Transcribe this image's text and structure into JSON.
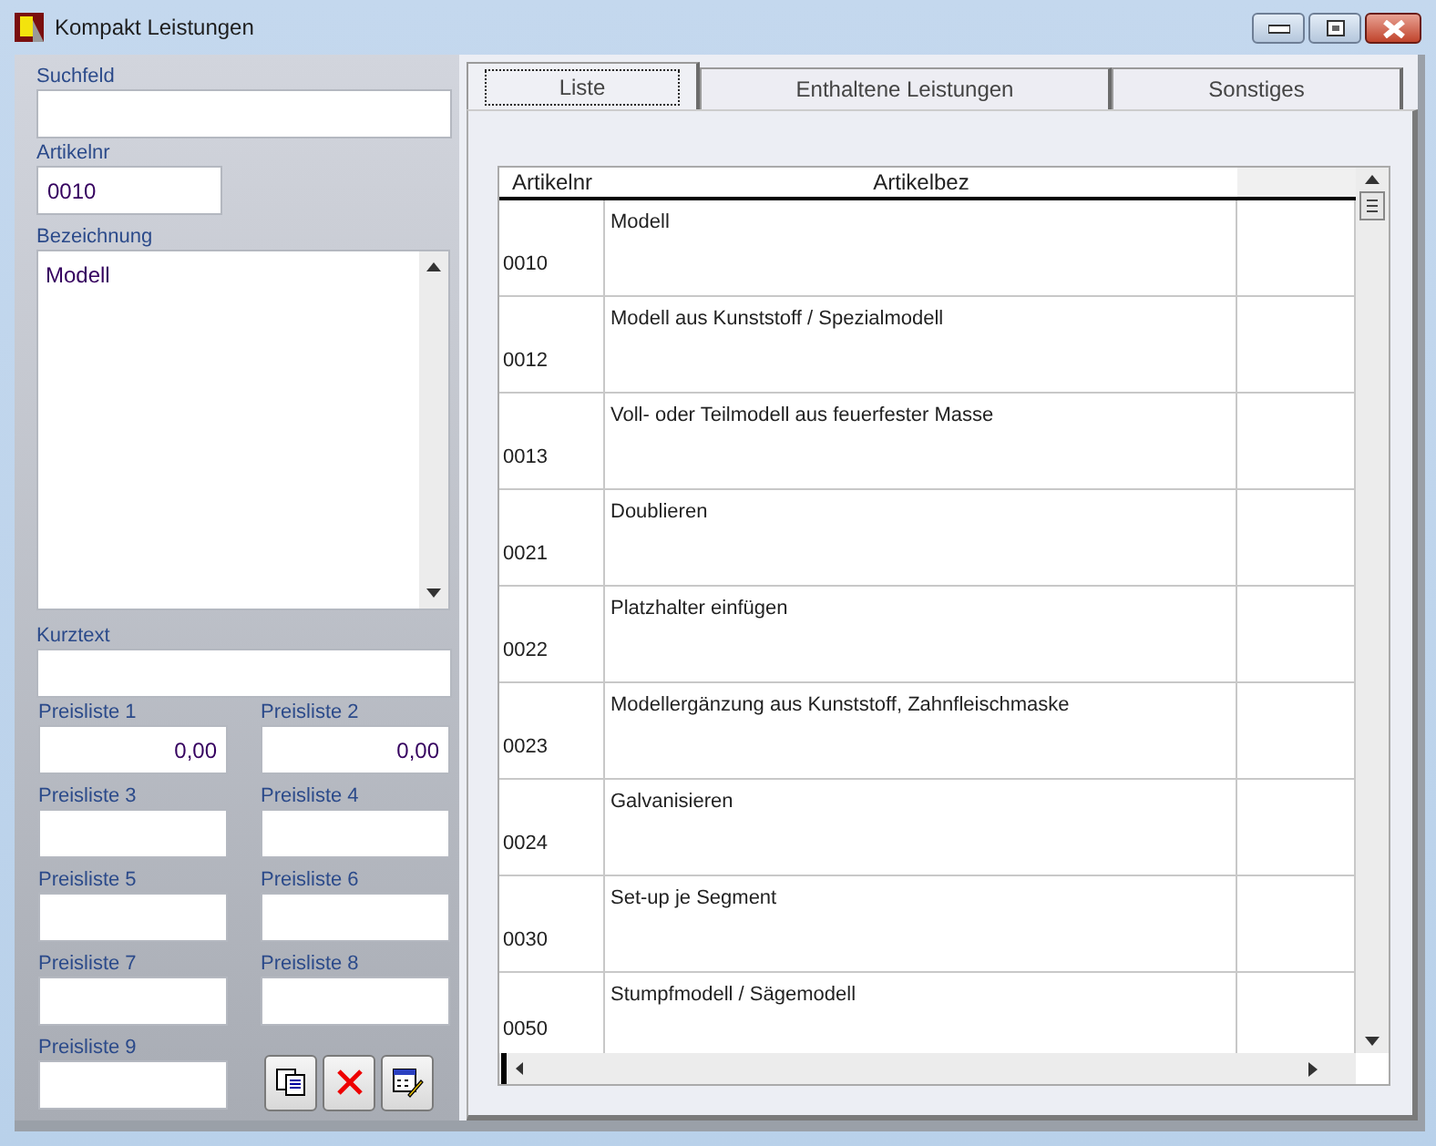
{
  "window": {
    "title": "Kompakt Leistungen"
  },
  "fields": [
    {
      "label": "Suchfeld",
      "kind": "wide"
    },
    {
      "label": "Artikelnr",
      "value": "0010",
      "kind": "short"
    },
    {
      "label": "Bezeichnung",
      "value": "Modell",
      "kind": "multiline"
    },
    {
      "label": "Kurztext",
      "kind": "wide"
    }
  ],
  "price_lists": [
    {
      "label": "Preisliste 1",
      "value": "0,00"
    },
    {
      "label": "Preisliste 2",
      "value": "0,00"
    },
    {
      "label": "Preisliste 3"
    },
    {
      "label": "Preisliste 4"
    },
    {
      "label": "Preisliste 5"
    },
    {
      "label": "Preisliste 6"
    },
    {
      "label": "Preisliste 7"
    },
    {
      "label": "Preisliste 8"
    },
    {
      "label": "Preisliste 9"
    }
  ],
  "tabs": [
    {
      "label": "Liste",
      "selected": true
    },
    {
      "label": "Enthaltene Leistungen",
      "selected": false
    },
    {
      "label": "Sonstiges",
      "selected": false
    }
  ],
  "table": {
    "columns": [
      "Artikelnr",
      "Artikelbez"
    ],
    "rows": [
      {
        "artikelnr": "0010",
        "artikelbez": "Modell"
      },
      {
        "artikelnr": "0012",
        "artikelbez": "Modell aus Kunststoff / Spezialmodell"
      },
      {
        "artikelnr": "0013",
        "artikelbez": "Voll- oder Teilmodell aus feuerfester Masse"
      },
      {
        "artikelnr": "0021",
        "artikelbez": "Doublieren"
      },
      {
        "artikelnr": "0022",
        "artikelbez": "Platzhalter einfügen"
      },
      {
        "artikelnr": "0023",
        "artikelbez": "Modellergänzung aus Kunststoff, Zahnfleischmaske"
      },
      {
        "artikelnr": "0024",
        "artikelbez": "Galvanisieren"
      },
      {
        "artikelnr": "0030",
        "artikelbez": "Set-up je Segment"
      },
      {
        "artikelnr": "0050",
        "artikelbez": "Stumpfmodell / Sägemodell"
      }
    ]
  }
}
